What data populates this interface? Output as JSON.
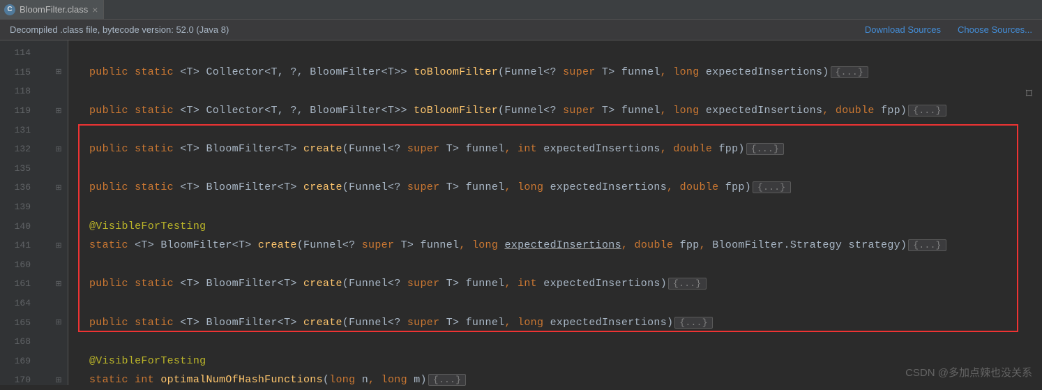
{
  "tab": {
    "filename": "BloomFilter.class"
  },
  "infobar": {
    "message": "Decompiled .class file, bytecode version: 52.0 (Java 8)",
    "download": "Download Sources",
    "choose": "Choose Sources..."
  },
  "gutter": [
    {
      "no": "114"
    },
    {
      "no": "115",
      "fold": true
    },
    {
      "no": "118"
    },
    {
      "no": "119",
      "fold": true
    },
    {
      "no": "131"
    },
    {
      "no": "132",
      "fold": true
    },
    {
      "no": "135"
    },
    {
      "no": "136",
      "fold": true
    },
    {
      "no": "139"
    },
    {
      "no": "140"
    },
    {
      "no": "141",
      "fold": true
    },
    {
      "no": "160"
    },
    {
      "no": "161",
      "fold": true
    },
    {
      "no": "164"
    },
    {
      "no": "165",
      "fold": true
    },
    {
      "no": "168"
    },
    {
      "no": "169"
    },
    {
      "no": "170",
      "fold": true
    }
  ],
  "code": {
    "l115": {
      "prefix": "public static ",
      "gen": "<T> ",
      "ret": "Collector<T, ?, BloomFilter<T>> ",
      "name": "toBloomFilter",
      "params": "(Funnel<? super T> funnel, long expectedInsertions)"
    },
    "l119": {
      "prefix": "public static ",
      "gen": "<T> ",
      "ret": "Collector<T, ?, BloomFilter<T>> ",
      "name": "toBloomFilter",
      "params": "(Funnel<? super T> funnel, long expectedInsertions, double fpp)"
    },
    "l132": {
      "prefix": "public static ",
      "gen": "<T> ",
      "ret": "BloomFilter<T> ",
      "name": "create",
      "params": "(Funnel<? super T> funnel, int expectedInsertions, double fpp)"
    },
    "l136": {
      "prefix": "public static ",
      "gen": "<T> ",
      "ret": "BloomFilter<T> ",
      "name": "create",
      "params": "(Funnel<? super T> funnel, long expectedInsertions, double fpp)"
    },
    "l140_ann": "@VisibleForTesting",
    "l141": {
      "prefix": "static ",
      "gen": "<T> ",
      "ret": "BloomFilter<T> ",
      "name": "create",
      "p1": "(Funnel<? super T> funnel, long ",
      "u": "expectedInsertions",
      "p2": ", double fpp, BloomFilter.Strategy strategy)"
    },
    "l161": {
      "prefix": "public static ",
      "gen": "<T> ",
      "ret": "BloomFilter<T> ",
      "name": "create",
      "params": "(Funnel<? super T> funnel, int expectedInsertions)"
    },
    "l165": {
      "prefix": "public static ",
      "gen": "<T> ",
      "ret": "BloomFilter<T> ",
      "name": "create",
      "params": "(Funnel<? super T> funnel, long expectedInsertions)"
    },
    "l169_ann": "@VisibleForTesting",
    "l170": {
      "prefix": "static ",
      "ret": "int ",
      "name": "optimalNumOfHashFunctions",
      "params": "(long n, long m)"
    },
    "folded": "{...}"
  },
  "watermark": "CSDN @多加点辣也没关系"
}
